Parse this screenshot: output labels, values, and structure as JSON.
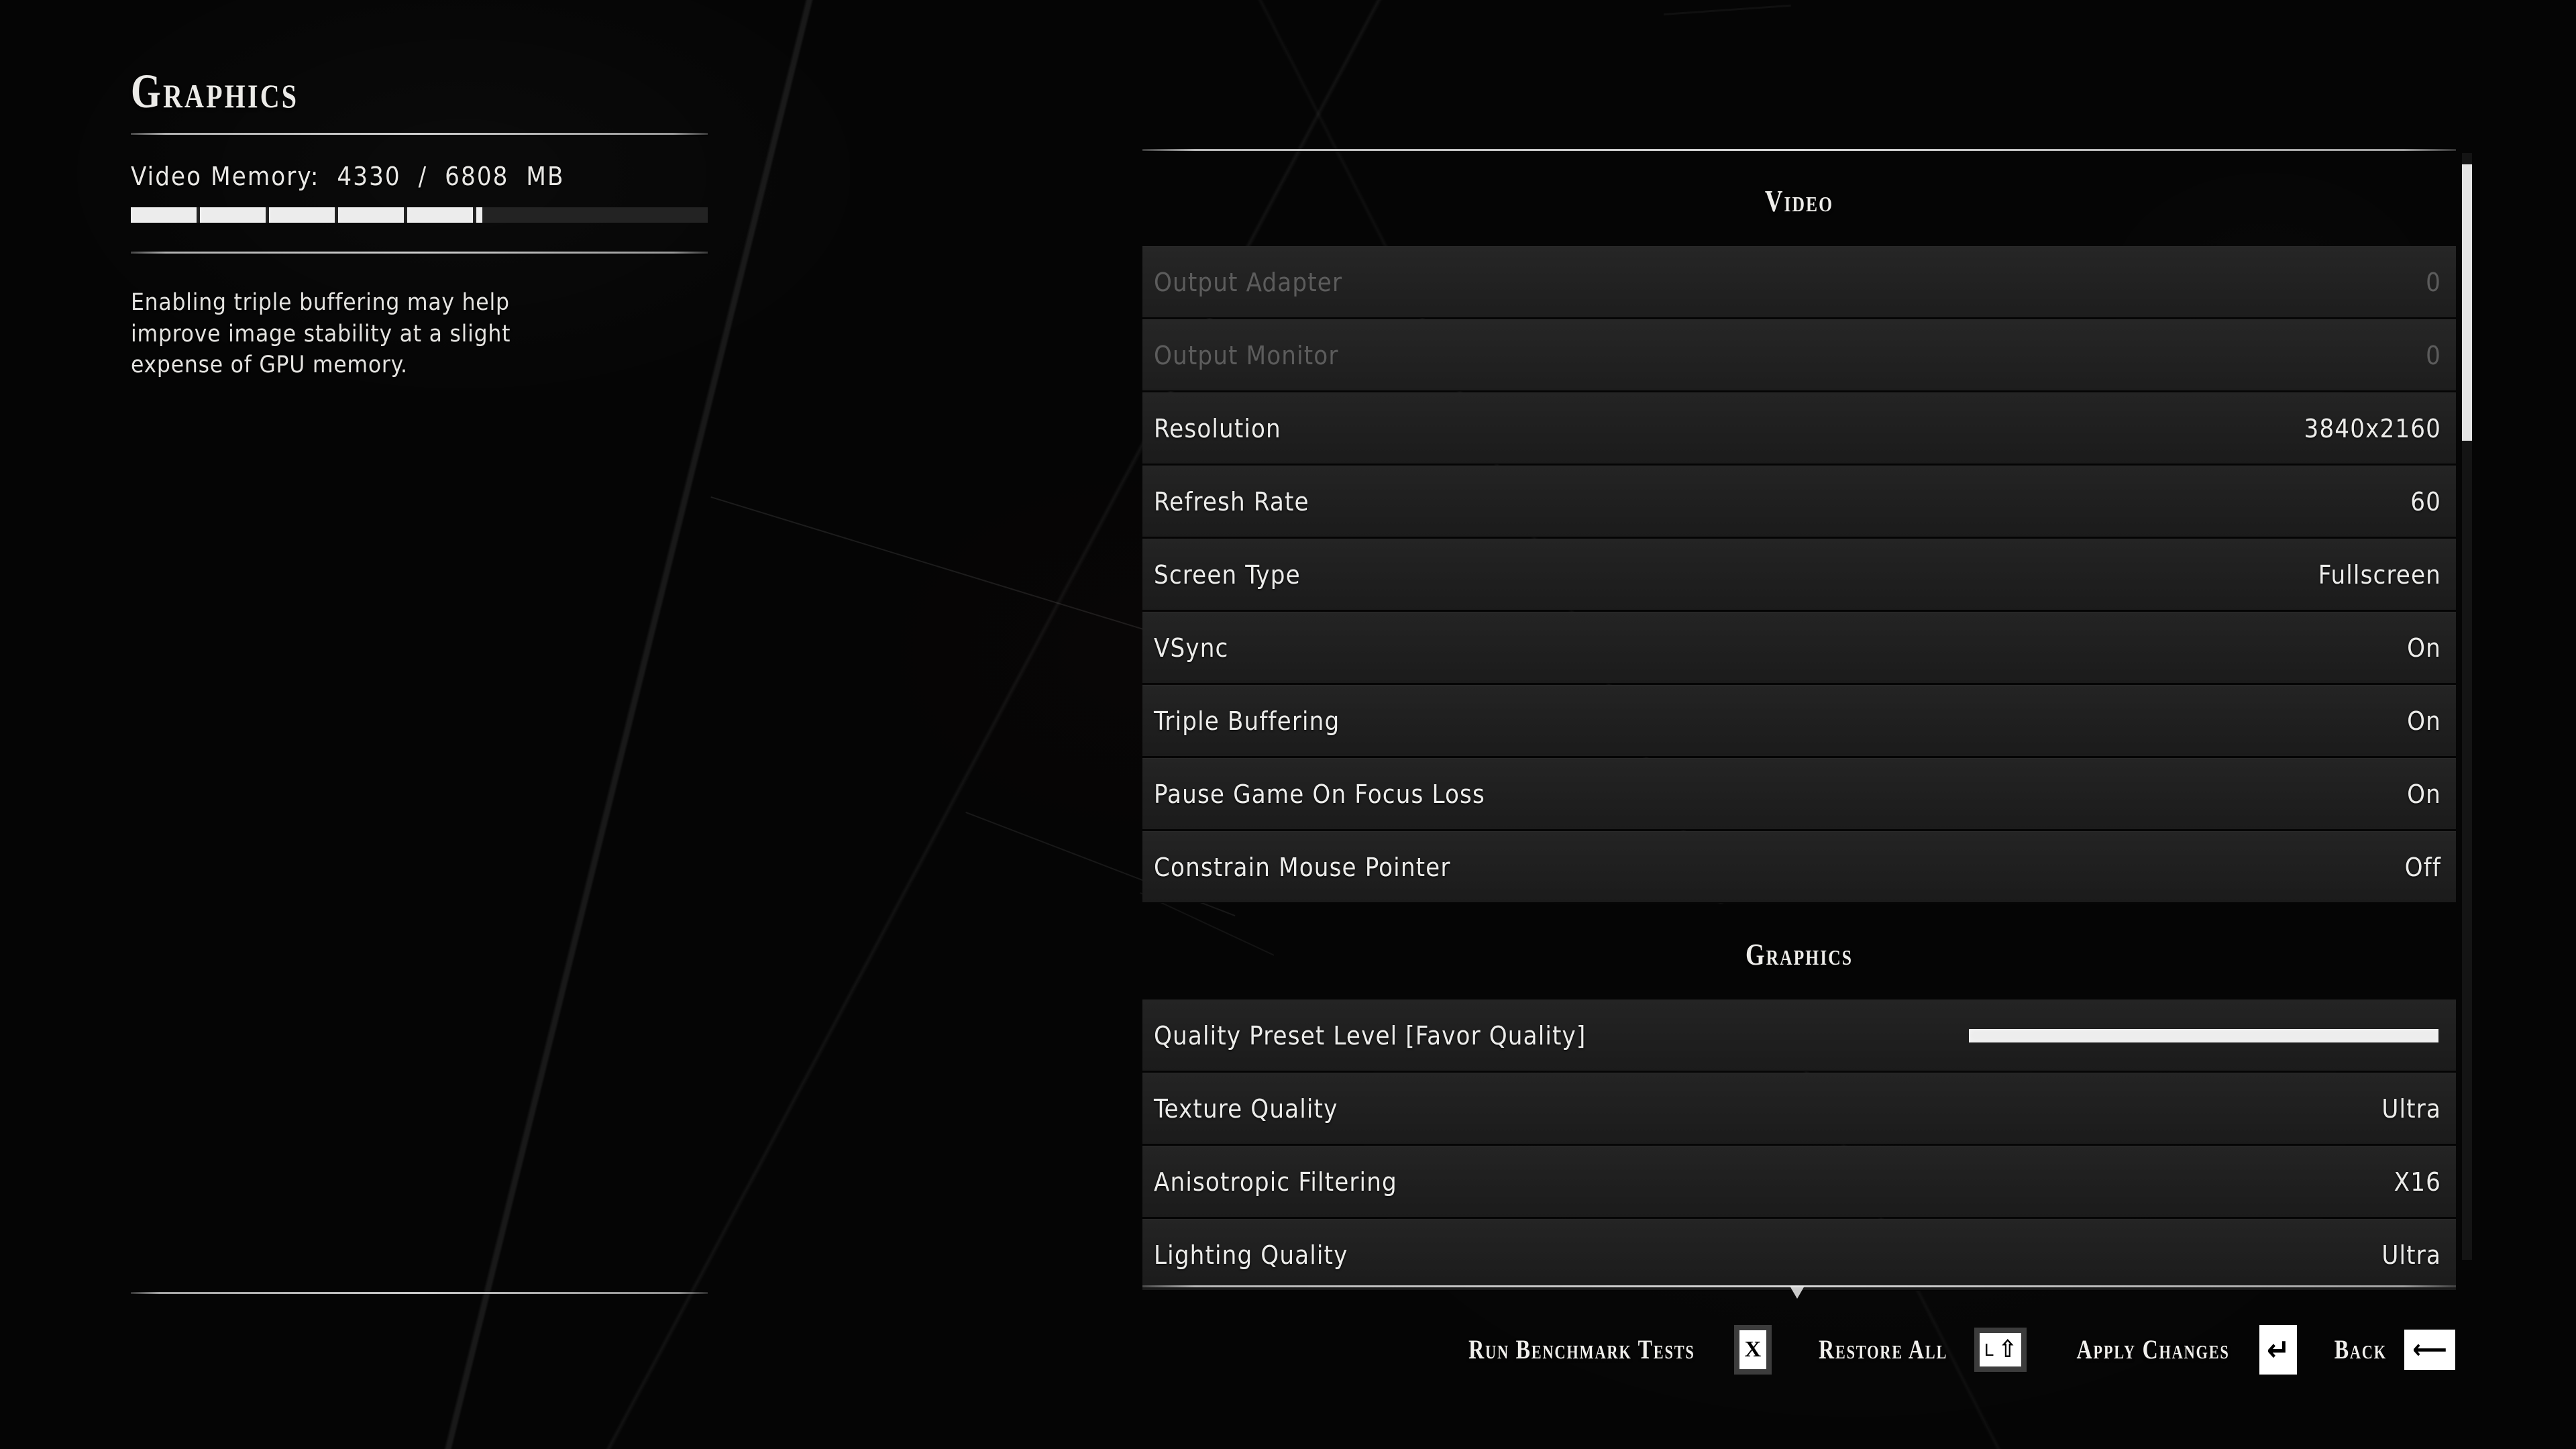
{
  "page": {
    "title": "Graphics"
  },
  "left_panel": {
    "vram_label": "Video Memory:",
    "vram_used": "4330",
    "vram_separator": "/",
    "vram_total": "6808",
    "vram_unit": "MB",
    "vram_text": "Video Memory:  4330  /  6808  MB",
    "memory_bar": {
      "segments_filled": 5,
      "partial_segment": true,
      "used_mb": 4330,
      "total_mb": 6808,
      "fill_color": "#ececec",
      "track_color": "#232323"
    },
    "description": "Enabling triple buffering may help improve image stability at a slight expense of GPU memory."
  },
  "right_panel": {
    "sections": [
      {
        "heading": "Video",
        "rows": [
          {
            "label": "Output Adapter",
            "value": "0",
            "type": "value",
            "disabled": true
          },
          {
            "label": "Output Monitor",
            "value": "0",
            "type": "value",
            "disabled": true
          },
          {
            "label": "Resolution",
            "value": "3840x2160",
            "type": "value",
            "disabled": false
          },
          {
            "label": "Refresh Rate",
            "value": "60",
            "type": "value",
            "disabled": false
          },
          {
            "label": "Screen Type",
            "value": "Fullscreen",
            "type": "value",
            "disabled": false
          },
          {
            "label": "VSync",
            "value": "On",
            "type": "value",
            "disabled": false
          },
          {
            "label": "Triple Buffering",
            "value": "On",
            "type": "value",
            "disabled": false
          },
          {
            "label": "Pause Game On Focus Loss",
            "value": "On",
            "type": "value",
            "disabled": false
          },
          {
            "label": "Constrain Mouse Pointer",
            "value": "Off",
            "type": "value",
            "disabled": false
          }
        ]
      },
      {
        "heading": "Graphics",
        "rows": [
          {
            "label": "Quality Preset Level  [Favor Quality]",
            "value": "",
            "type": "slider",
            "slider_percent": 100,
            "disabled": false
          },
          {
            "label": "Texture Quality",
            "value": "Ultra",
            "type": "value",
            "disabled": false
          },
          {
            "label": "Anisotropic Filtering",
            "value": "X16",
            "type": "value",
            "disabled": false
          },
          {
            "label": "Lighting Quality",
            "value": "Ultra",
            "type": "value",
            "disabled": false
          }
        ]
      }
    ],
    "scrollbar": {
      "thumb_top_percent": 1,
      "thumb_height_percent": 25
    }
  },
  "actions": [
    {
      "label": "Run Benchmark Tests",
      "key_glyph": "X",
      "key_style": "bordered",
      "key_name": "key-x"
    },
    {
      "label": "Restore All",
      "key_glyph": "L⇧",
      "key_style": "bordered",
      "key_name": "key-left-shift"
    },
    {
      "label": "Apply Changes",
      "key_glyph": "↵",
      "key_style": "plain",
      "key_name": "key-enter"
    },
    {
      "label": "Back",
      "key_glyph": "⟵",
      "key_style": "plain",
      "key_name": "key-backspace"
    }
  ],
  "colors": {
    "background": "#050505",
    "row_background": "#202020",
    "text": "#ececea",
    "text_disabled": "#5c5c5c",
    "accent_white": "#ededed"
  }
}
